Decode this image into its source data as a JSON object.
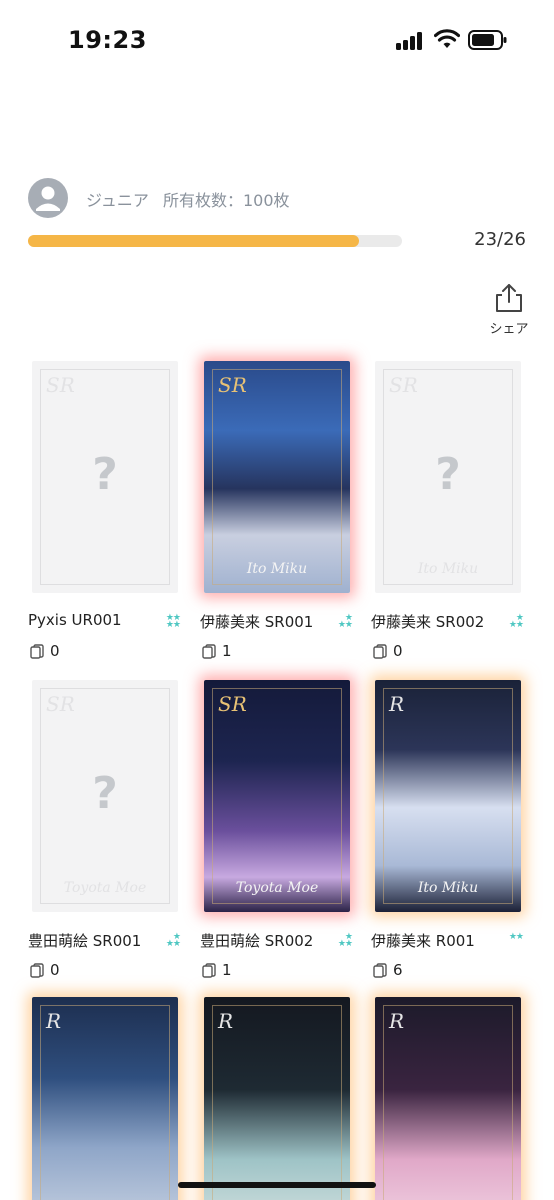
{
  "status_bar": {
    "time": "19:23"
  },
  "profile": {
    "name": "ジュニア",
    "owned": "所有枚数：100枚"
  },
  "progress": {
    "fraction": 0.885,
    "label": "23/26"
  },
  "share": {
    "label": "シェア"
  },
  "cards": [
    {
      "title": "Pyxis UR001",
      "stars": "★★\n★★",
      "quantity": "0",
      "locked": true,
      "rarity": "SR",
      "script_name": ""
    },
    {
      "title": "伊藤美来 SR001",
      "stars": "★\n★★",
      "quantity": "1",
      "locked": false,
      "rarity": "SR",
      "script_name": "Ito Miku"
    },
    {
      "title": "伊藤美来 SR002",
      "stars": "★\n★★",
      "quantity": "0",
      "locked": true,
      "rarity": "SR",
      "script_name": "Ito Miku"
    },
    {
      "title": "豊田萌絵 SR001",
      "stars": "★\n★★",
      "quantity": "0",
      "locked": true,
      "rarity": "SR",
      "script_name": "Toyota Moe"
    },
    {
      "title": "豊田萌絵 SR002",
      "stars": "★\n★★",
      "quantity": "1",
      "locked": false,
      "rarity": "SR",
      "script_name": "Toyota Moe"
    },
    {
      "title": "伊藤美来 R001",
      "stars": "★★",
      "quantity": "6",
      "locked": false,
      "rarity": "R",
      "script_name": "Ito Miku"
    },
    {
      "title": "",
      "stars": "",
      "quantity": "",
      "locked": false,
      "rarity": "R",
      "script_name": ""
    },
    {
      "title": "",
      "stars": "",
      "quantity": "",
      "locked": false,
      "rarity": "R",
      "script_name": ""
    },
    {
      "title": "",
      "stars": "",
      "quantity": "",
      "locked": false,
      "rarity": "R",
      "script_name": ""
    }
  ],
  "colors": {
    "progress": "#f5b647",
    "stars": "#4fc7c2"
  }
}
